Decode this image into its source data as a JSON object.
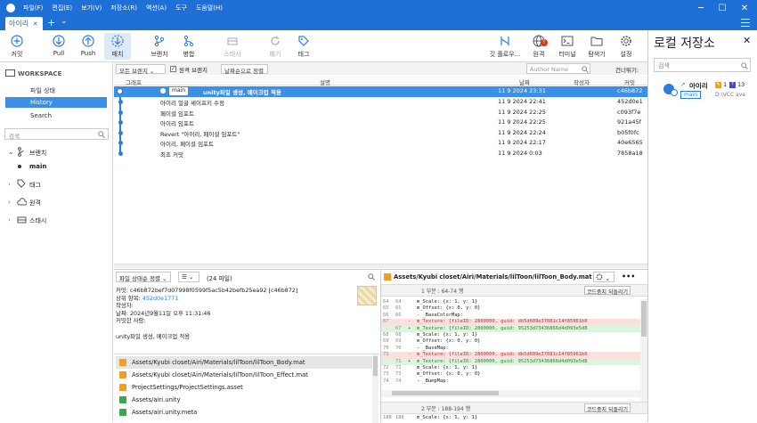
{
  "titlebar": {
    "menus": [
      "파일(F)",
      "편집(E)",
      "보기(V)",
      "저장소(R)",
      "액션(A)",
      "도구",
      "도움말(H)"
    ],
    "tab_label": "아이리",
    "tab_add": "+",
    "tab_menu": "⌄"
  },
  "toolbar": {
    "commit": "커밋",
    "pull": "Pull",
    "push": "Push",
    "fetch": "패치",
    "branch": "브랜치",
    "merge": "병합",
    "stash": "스태시",
    "discard": "폐기",
    "tag": "태그",
    "gitflow": "깃 플로우...",
    "remote": "원격",
    "terminal": "터미널",
    "explorer": "탐색기",
    "settings": "설정",
    "remote_badge": "!"
  },
  "sidebar": {
    "workspace": "WORKSPACE",
    "file_status": "파일 상태",
    "history": "History",
    "search_label": "Search",
    "search_placeholder": "검색",
    "branches": "브랜치",
    "main_branch": "main",
    "tags": "태그",
    "remotes": "원격",
    "stashes": "스태시"
  },
  "filterbar": {
    "all_branches": "모든 브랜치 ⌄",
    "remote_branches": "원격 브랜치",
    "date_order": "날짜순으로 정렬 ⌄",
    "author_placeholder": "Author Name",
    "skip": "건너뛰기:"
  },
  "columns": {
    "graph": "그래프",
    "desc": "설명",
    "date": "날짜",
    "author": "작성자",
    "commit": "커밋"
  },
  "commits": [
    {
      "badge": "main",
      "desc": "unity파일 생성, 메이크업 적용",
      "date": "11 9 2024 23:31",
      "hash": "c46b872",
      "selected": true
    },
    {
      "desc": "아이리 얼굴 셰이프키 수정",
      "date": "11 9 2024 22:41",
      "hash": "452d0e1"
    },
    {
      "desc": "페이셜 임포트",
      "date": "11 9 2024 22:25",
      "hash": "c093f7e"
    },
    {
      "desc": "아이리 임포트",
      "date": "11 9 2024 22:25",
      "hash": "921a45f"
    },
    {
      "desc": "Revert \"아이리, 페이셜 임포트\"",
      "date": "11 9 2024 22:24",
      "hash": "b05f0fc"
    },
    {
      "desc": "아이리, 페이셜 임포트",
      "date": "11 9 2024 22:17",
      "hash": "40e6565"
    },
    {
      "desc": "최초 커밋",
      "date": "11 9 2024 0:03",
      "hash": "7858a18"
    }
  ],
  "details": {
    "sort_label": "파일 상태순 정렬 ⌄",
    "list_icon": "☰ ⌄",
    "file_count": "(24 파일)",
    "commit_line": "커밋: c46b872bef7d07998f0599f5ac5b42befb25ea92 [c46b872]",
    "parent_label": "상위 항목:",
    "parent_hash": "452d0e1771",
    "author": "작성자:",
    "date": "날짜: 2024년9월11일 오후 11:31:46",
    "committer": "커밋한 사람:",
    "message": "unity파일 생성, 메이크업 적용"
  },
  "files": [
    {
      "path": "Assets/Kyubi closet/Airi/Materials/lilToon/lilToon_Body.mat",
      "status": "mod",
      "selected": true
    },
    {
      "path": "Assets/Kyubi closet/Airi/Materials/lilToon/lilToon_Effect.mat",
      "status": "mod"
    },
    {
      "path": "ProjectSettings/ProjectSettings.asset",
      "status": "mod"
    },
    {
      "path": "Assets/airi.unity",
      "status": "add"
    },
    {
      "path": "Assets/airi.unity.meta",
      "status": "add"
    }
  ],
  "diff": {
    "file_title": "Assets/Kyubi closet/Airi/Materials/lilToon/lilToon_Body.mat",
    "hunk1": "1 부분 : 64-74 행",
    "hunk_button": "코드중지 되돌리기",
    "hunk2": "2 부분 : 188-194 행",
    "lines": [
      {
        "n1": "64",
        "n2": "64",
        "type": "ctx",
        "text": "        m_Scale: {x: 1, y: 1}"
      },
      {
        "n1": "65",
        "n2": "65",
        "type": "ctx",
        "text": "        m_Offset: {x: 0, y: 0}"
      },
      {
        "n1": "66",
        "n2": "66",
        "type": "ctx",
        "text": "    - _BaseColorMap:"
      },
      {
        "n1": "67",
        "n2": "",
        "type": "del",
        "text": "        m_Texture: {fileID: 2800000, guid: db5d609e37081c14f85961b0"
      },
      {
        "n1": "",
        "n2": "67",
        "type": "add",
        "text": "        m_Texture: {fileID: 2800000, guid: 95253d73436866d4d093e5d8"
      },
      {
        "n1": "68",
        "n2": "68",
        "type": "ctx",
        "text": "        m_Scale: {x: 1, y: 1}"
      },
      {
        "n1": "69",
        "n2": "69",
        "type": "ctx",
        "text": "        m_Offset: {x: 0, y: 0}"
      },
      {
        "n1": "70",
        "n2": "70",
        "type": "ctx",
        "text": "    - _BaseMap:"
      },
      {
        "n1": "71",
        "n2": "",
        "type": "del",
        "text": "        m_Texture: {fileID: 2800000, guid: db5d609e37081c14f85961b0"
      },
      {
        "n1": "",
        "n2": "71",
        "type": "add",
        "text": "        m_Texture: {fileID: 2800000, guid: 95253d73436866d4d093e5d8"
      },
      {
        "n1": "72",
        "n2": "72",
        "type": "ctx",
        "text": "        m_Scale: {x: 1, y: 1}"
      },
      {
        "n1": "73",
        "n2": "73",
        "type": "ctx",
        "text": "        m_Offset: {x: 0, y: 0}"
      },
      {
        "n1": "74",
        "n2": "74",
        "type": "ctx",
        "text": "    - _BumpMap:"
      }
    ],
    "line_188": {
      "n1": "188",
      "n2": "188",
      "text": "        m_Scale: {x: 1, y: 1}"
    }
  },
  "right_panel": {
    "title": "로컬 저장소",
    "search_placeholder": "검색",
    "repo_name": "아이리",
    "repo_branch": "main",
    "repo_path": "D:\\VCC ava",
    "badge1": "1",
    "badge2": "13"
  },
  "colors": {
    "accent": "#1e6fd6",
    "selection": "#3d8ee6",
    "graph": "#2a7de1"
  }
}
